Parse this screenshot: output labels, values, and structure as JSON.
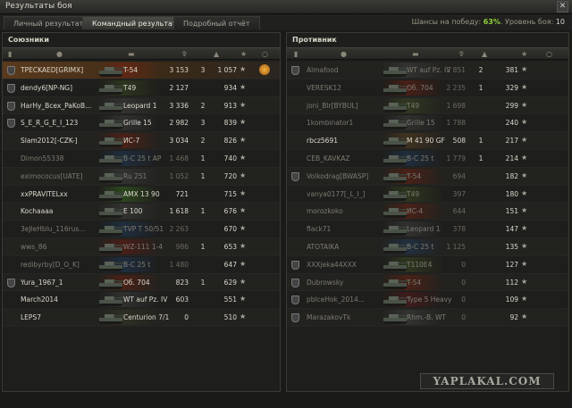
{
  "window": {
    "title": "Результаты боя",
    "close": "✕"
  },
  "tabs": [
    {
      "label": "Личный результат",
      "active": false
    },
    {
      "label": "Командный результат",
      "active": true
    },
    {
      "label": "Подробный отчёт",
      "active": false
    }
  ],
  "chance": {
    "label": "Шансы на победу:",
    "value": "63%",
    "level_label": "Уровень боя:",
    "level": "10"
  },
  "allies": {
    "title": "Союзники",
    "rows": [
      {
        "clan": true,
        "name": "TPECKAED[GRIMX]",
        "tank": "T-54",
        "damage": "3 153",
        "kills": "3",
        "xp": "1 057",
        "dead": false,
        "medal": true,
        "style": "highlight",
        "flag": "#7a2010"
      },
      {
        "clan": true,
        "name": "dendy6[NP-NG]",
        "tank": "T49",
        "damage": "2 127",
        "kills": "",
        "xp": "934",
        "dead": false,
        "medal": false,
        "style": "",
        "flag": "#3a4a20"
      },
      {
        "clan": true,
        "name": "HarHy_Bcex_PaKoB...",
        "tank": "Leopard 1",
        "damage": "3 336",
        "kills": "2",
        "xp": "913",
        "dead": false,
        "medal": false,
        "style": "",
        "flag": "#404040"
      },
      {
        "clan": true,
        "name": "S_E_R_G_E_I_123",
        "tank": "Grille 15",
        "damage": "2 982",
        "kills": "3",
        "xp": "839",
        "dead": false,
        "medal": false,
        "style": "",
        "flag": "#404040"
      },
      {
        "clan": false,
        "name": "Slam2012[-CZK-]",
        "tank": "ИС-7",
        "damage": "3 034",
        "kills": "2",
        "xp": "826",
        "dead": false,
        "medal": false,
        "style": "",
        "flag": "#6a2010"
      },
      {
        "clan": false,
        "name": "Dimon55338",
        "tank": "B-C 25 t AP",
        "damage": "1 468",
        "kills": "1",
        "xp": "740",
        "dead": true,
        "medal": false,
        "style": "",
        "flag": "#203a5a"
      },
      {
        "clan": false,
        "name": "eximococus[UATE]",
        "tank": "Ru 251",
        "damage": "1 052",
        "kills": "1",
        "xp": "720",
        "dead": true,
        "medal": false,
        "style": "",
        "flag": "#404040"
      },
      {
        "clan": false,
        "name": "xxPRAVITELxx",
        "tank": "AMX 13 90",
        "damage": "721",
        "kills": "",
        "xp": "715",
        "dead": false,
        "medal": false,
        "style": "",
        "flag": "#3a6a20"
      },
      {
        "clan": false,
        "name": "Kochaaaa",
        "tank": "E 100",
        "damage": "1 618",
        "kills": "1",
        "xp": "676",
        "dead": false,
        "medal": false,
        "style": "",
        "flag": "#404040"
      },
      {
        "clan": false,
        "name": "3eJleHblu_116rus...",
        "tank": "TVP T 50/51",
        "damage": "2 263",
        "kills": "",
        "xp": "670",
        "dead": true,
        "medal": false,
        "style": "",
        "flag": "#203a5a"
      },
      {
        "clan": false,
        "name": "wws_86",
        "tank": "WZ-111 1-4",
        "damage": "986",
        "kills": "1",
        "xp": "653",
        "dead": true,
        "medal": false,
        "style": "",
        "flag": "#6a1a10"
      },
      {
        "clan": false,
        "name": "redibyrby[D_O_K]",
        "tank": "B-C 25 t",
        "damage": "1 480",
        "kills": "",
        "xp": "647",
        "dead": true,
        "medal": false,
        "style": "",
        "flag": "#203a5a"
      },
      {
        "clan": true,
        "name": "Yura_1967_1",
        "tank": "Об. 704",
        "damage": "823",
        "kills": "1",
        "xp": "629",
        "dead": false,
        "medal": false,
        "style": "",
        "flag": "#6a2010"
      },
      {
        "clan": false,
        "name": "March2014",
        "tank": "WT auf Pz. IV",
        "damage": "603",
        "kills": "",
        "xp": "551",
        "dead": false,
        "medal": false,
        "style": "",
        "flag": "#404040"
      },
      {
        "clan": false,
        "name": "LEPS7",
        "tank": "Centurion 7/1",
        "damage": "0",
        "kills": "",
        "xp": "510",
        "dead": false,
        "medal": false,
        "style": "",
        "flag": "#3a3a2a"
      }
    ]
  },
  "enemies": {
    "title": "Противник",
    "rows": [
      {
        "clan": true,
        "name": "Almafood",
        "tank": "WT auf Pz. IV",
        "damage": "2 851",
        "kills": "2",
        "xp": "381",
        "dead": true,
        "style": "",
        "flag": "#404040"
      },
      {
        "clan": false,
        "name": "VERESK12",
        "tank": "Об. 704",
        "damage": "2 235",
        "kills": "1",
        "xp": "329",
        "dead": true,
        "style": "",
        "flag": "#6a2010"
      },
      {
        "clan": false,
        "name": "joni_Blr[BYBUL]",
        "tank": "T49",
        "damage": "1 698",
        "kills": "",
        "xp": "299",
        "dead": true,
        "style": "",
        "flag": "#3a4a20"
      },
      {
        "clan": false,
        "name": "1kombinator1",
        "tank": "Grille 15",
        "damage": "1 788",
        "kills": "",
        "xp": "240",
        "dead": true,
        "style": "",
        "flag": "#404040"
      },
      {
        "clan": false,
        "name": "rbcz5691",
        "tank": "M 41 90 GF",
        "damage": "508",
        "kills": "1",
        "xp": "217",
        "dead": false,
        "style": "",
        "flag": "#5a4020"
      },
      {
        "clan": false,
        "name": "CEB_KAVKAZ",
        "tank": "B-C 25 t",
        "damage": "1 779",
        "kills": "1",
        "xp": "214",
        "dead": true,
        "style": "",
        "flag": "#203a5a"
      },
      {
        "clan": true,
        "name": "Volkodrag[BWASP]",
        "tank": "T-54",
        "damage": "694",
        "kills": "",
        "xp": "182",
        "dead": true,
        "style": "",
        "flag": "#6a2010"
      },
      {
        "clan": false,
        "name": "vanya0177[_L_I_]",
        "tank": "T49",
        "damage": "397",
        "kills": "",
        "xp": "180",
        "dead": true,
        "style": "",
        "flag": "#3a4a20"
      },
      {
        "clan": false,
        "name": "morozkoko",
        "tank": "ИС-4",
        "damage": "644",
        "kills": "",
        "xp": "151",
        "dead": true,
        "style": "",
        "flag": "#6a2010"
      },
      {
        "clan": false,
        "name": "flack71",
        "tank": "Leopard 1",
        "damage": "378",
        "kills": "",
        "xp": "147",
        "dead": true,
        "style": "",
        "flag": "#404040"
      },
      {
        "clan": false,
        "name": "ATOTAIKA",
        "tank": "B-C 25 t",
        "damage": "1 125",
        "kills": "",
        "xp": "135",
        "dead": true,
        "style": "",
        "flag": "#203a5a"
      },
      {
        "clan": true,
        "name": "XXXjeka44XXX",
        "tank": "T110E4",
        "damage": "0",
        "kills": "",
        "xp": "127",
        "dead": true,
        "style": "",
        "flag": "#3a4a20"
      },
      {
        "clan": true,
        "name": "Dubrowsky",
        "tank": "T-54",
        "damage": "0",
        "kills": "",
        "xp": "112",
        "dead": true,
        "style": "",
        "flag": "#6a2010"
      },
      {
        "clan": true,
        "name": "pblceHok_2014...",
        "tank": "Type 5 Heavy",
        "damage": "0",
        "kills": "",
        "xp": "109",
        "dead": true,
        "style": "",
        "flag": "#5a1a1a"
      },
      {
        "clan": true,
        "name": "MarazakovTk",
        "tank": "Rhm.-B. WT",
        "damage": "0",
        "kills": "",
        "xp": "92",
        "dead": true,
        "style": "",
        "flag": "#404040"
      }
    ]
  },
  "watermark": "YAPLAKAL.COM",
  "colors": {
    "accent": "#8fd13a",
    "highlight": "#5a3a1c",
    "medal": "#f0b040"
  }
}
